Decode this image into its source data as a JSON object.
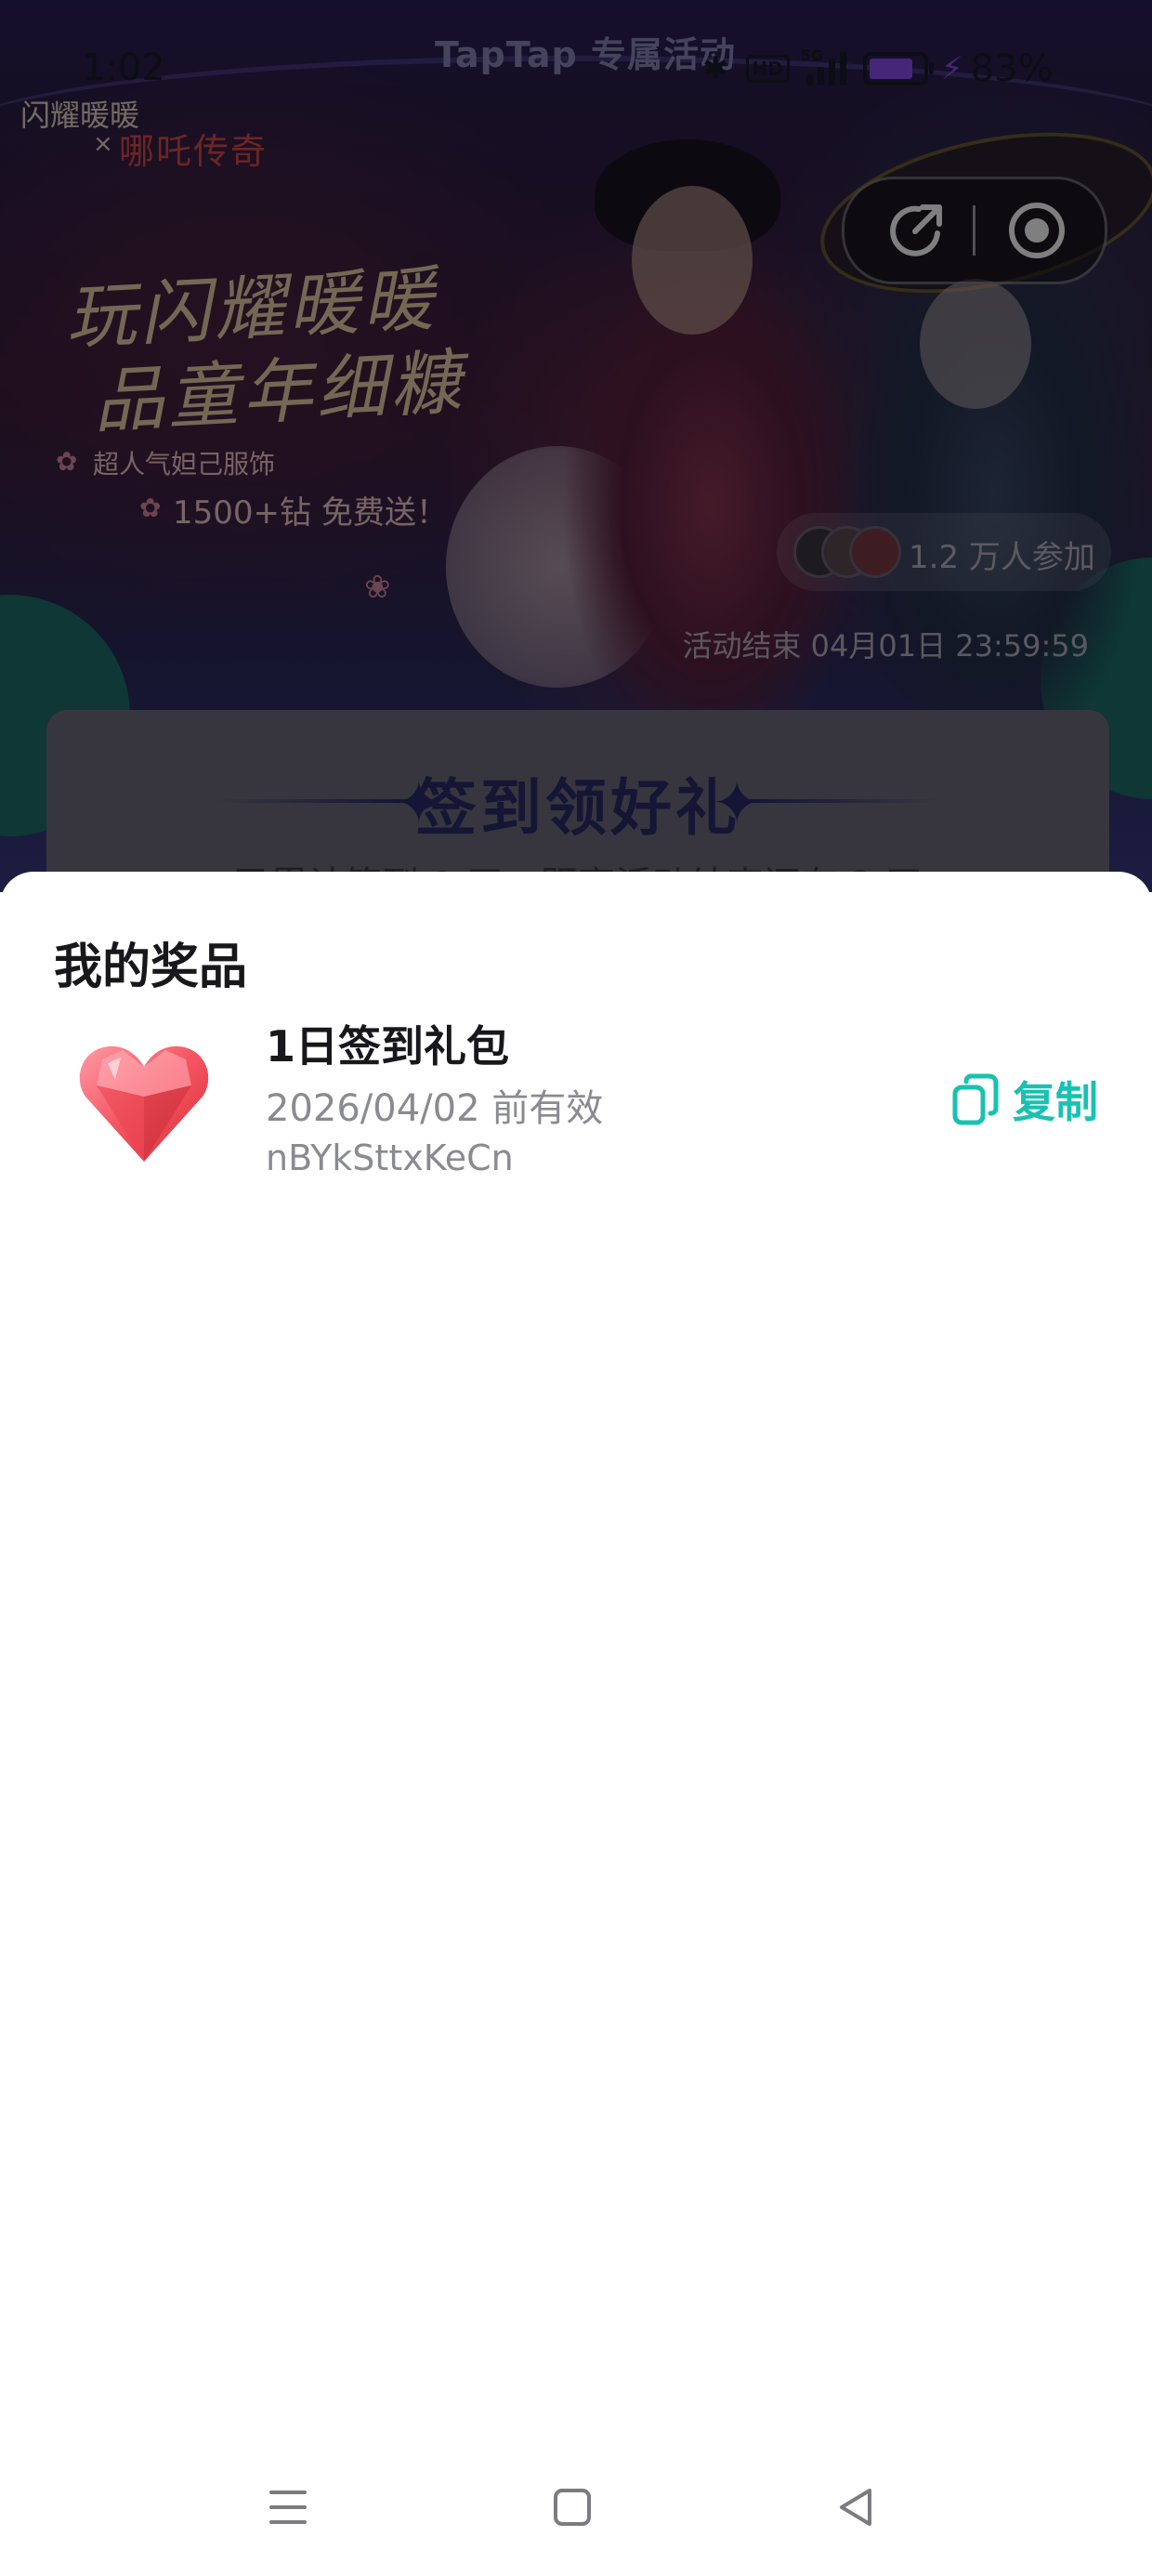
{
  "status_bar": {
    "time": "1:02",
    "page_title": "TapTap 专属活动",
    "network_label": "5G",
    "hd_label": "HD",
    "battery_percent": "83%",
    "battery_level": 0.83,
    "battery_color": "#8b4cf0"
  },
  "banner": {
    "brand": "闪耀暖暖",
    "collab_x": "×",
    "collab_title": "哪吒传奇",
    "headline_line1": "玩闪耀暖暖",
    "headline_line2": "品童年细糠",
    "promo_line1": "超人气妲己服饰",
    "promo_line2": "1500+钻 免费送！",
    "participants": "1.2 万人参加",
    "end_time": "活动结束 04月01日 23:59:59"
  },
  "capsule": {
    "share_icon": "share-icon",
    "record_icon": "record-icon"
  },
  "checkin": {
    "title": "签到领好礼",
    "subtitle": "已累计签到 1 天，距离活动结束还有 2 天"
  },
  "sheet": {
    "title": "我的奖品",
    "prizes": [
      {
        "name": "1日签到礼包",
        "validity": "2026/04/02 前有效",
        "code": "nBYkSttxKeCn",
        "icon": "heart-gem-icon",
        "copy_label": "复制"
      }
    ]
  },
  "colors": {
    "accent": "#19c1b1",
    "title_text": "#17171c",
    "secondary_text": "#8a8a92",
    "checkin_title": "#2a2a6a"
  },
  "nav": {
    "menu_icon": "menu-icon",
    "home_icon": "home-icon",
    "back_icon": "back-icon"
  }
}
